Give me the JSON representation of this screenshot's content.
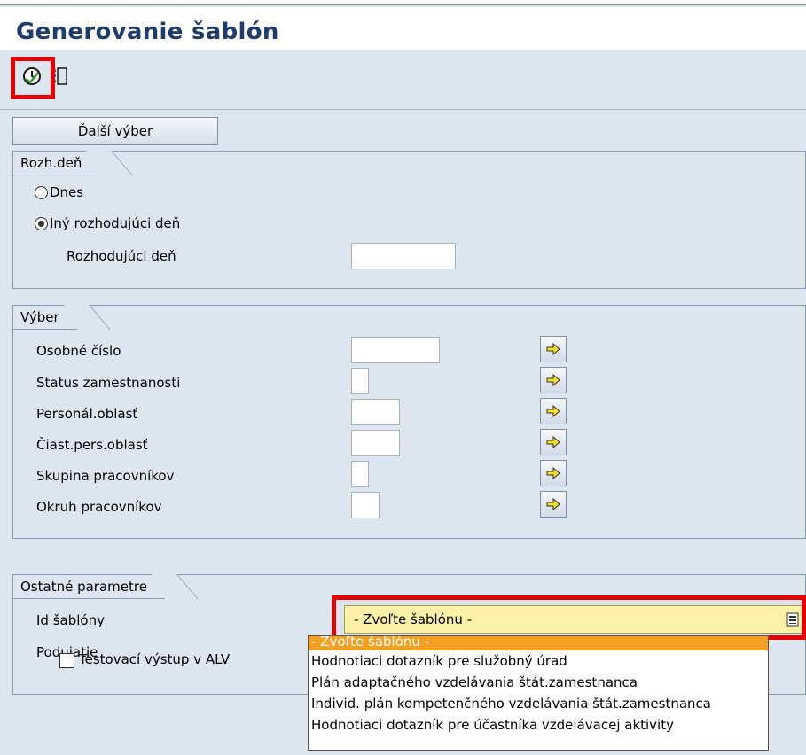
{
  "window": {
    "title": "Generovanie šablón"
  },
  "toolbar": {
    "execute_icon": "execute-clock-icon",
    "layout_icon": "list-layout-icon"
  },
  "buttons": {
    "more_selection": "Ďalší výber"
  },
  "group_decision_day": {
    "title": "Rozh.deň",
    "radio_today": "Dnes",
    "radio_other": "Iný rozhodujúci deň",
    "other_selected": true,
    "decision_day_label": "Rozhodujúci deň",
    "decision_day_value": ""
  },
  "group_selection": {
    "title": "Výber",
    "fields": [
      {
        "label": "Osobné číslo",
        "value": ""
      },
      {
        "label": "Status zamestnanosti",
        "value": ""
      },
      {
        "label": "Personál.oblasť",
        "value": ""
      },
      {
        "label": "Čiast.pers.oblasť",
        "value": ""
      },
      {
        "label": "Skupina pracovníkov",
        "value": ""
      },
      {
        "label": "Okruh pracovníkov",
        "value": ""
      }
    ]
  },
  "group_other": {
    "title": "Ostatné parametre",
    "template_id_label": "Id šablóny",
    "template_id_value": "- Zvoľte šablónu -",
    "event_label": "Podujatie",
    "alv_checkbox_label": "Testovací výstup v ALV",
    "alv_checked": false
  },
  "template_options": [
    "- Zvoľte šablónu -",
    "Hodnotiaci dotazník pre služobný úrad",
    "Plán adaptačného vzdelávania štát.zamestnanca",
    "Individ. plán kompetenčného vzdelávania štát.zamestnanca",
    "Hodnotiaci dotazník pre účastníka vzdelávacej aktivity"
  ],
  "colors": {
    "title": "#1f3d6b",
    "highlight": "#e60000",
    "dropdown_bg": "#fdf1a8",
    "selected_option": "#f5a020"
  }
}
